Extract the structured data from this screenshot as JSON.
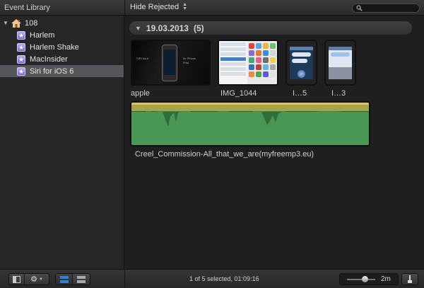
{
  "topbar": {
    "library_title": "Event Library",
    "filter_label": "Hide Rejected",
    "search_placeholder": ""
  },
  "sidebar": {
    "library": {
      "label": "108",
      "icon": "house-icon",
      "expanded": true
    },
    "events": [
      {
        "label": "Harlem",
        "icon": "star-event-icon",
        "selected": false
      },
      {
        "label": "Harlem Shake",
        "icon": "star-event-icon",
        "selected": false
      },
      {
        "label": "MacInsider",
        "icon": "star-event-icon",
        "selected": false
      },
      {
        "label": "Siri for iOS 6",
        "icon": "star-event-icon",
        "selected": true
      }
    ]
  },
  "browser": {
    "group": {
      "date": "19.03.2013",
      "count": "(5)"
    },
    "clips": [
      {
        "label": "apple",
        "kind": "video"
      },
      {
        "label": "IMG_1044",
        "kind": "screenshot"
      },
      {
        "label": "I…5",
        "kind": "phone-screen"
      },
      {
        "label": "I…3",
        "kind": "phone-screen"
      }
    ],
    "audio_clip": {
      "label": "Creel_Commission-All_that_we_are(myfreemp3.eu)"
    }
  },
  "bottombar": {
    "status": "1 of 5 selected, 01:09:16",
    "zoom_value": "2m",
    "zoom_level": 0.5
  },
  "colors": {
    "background": "#1f1f1f",
    "selection": "#555659",
    "audio_green": "#3f8a4b",
    "audio_peak": "#d9b84a",
    "event_badge": "#8f7de0",
    "active_view": "#2f7fe0"
  }
}
